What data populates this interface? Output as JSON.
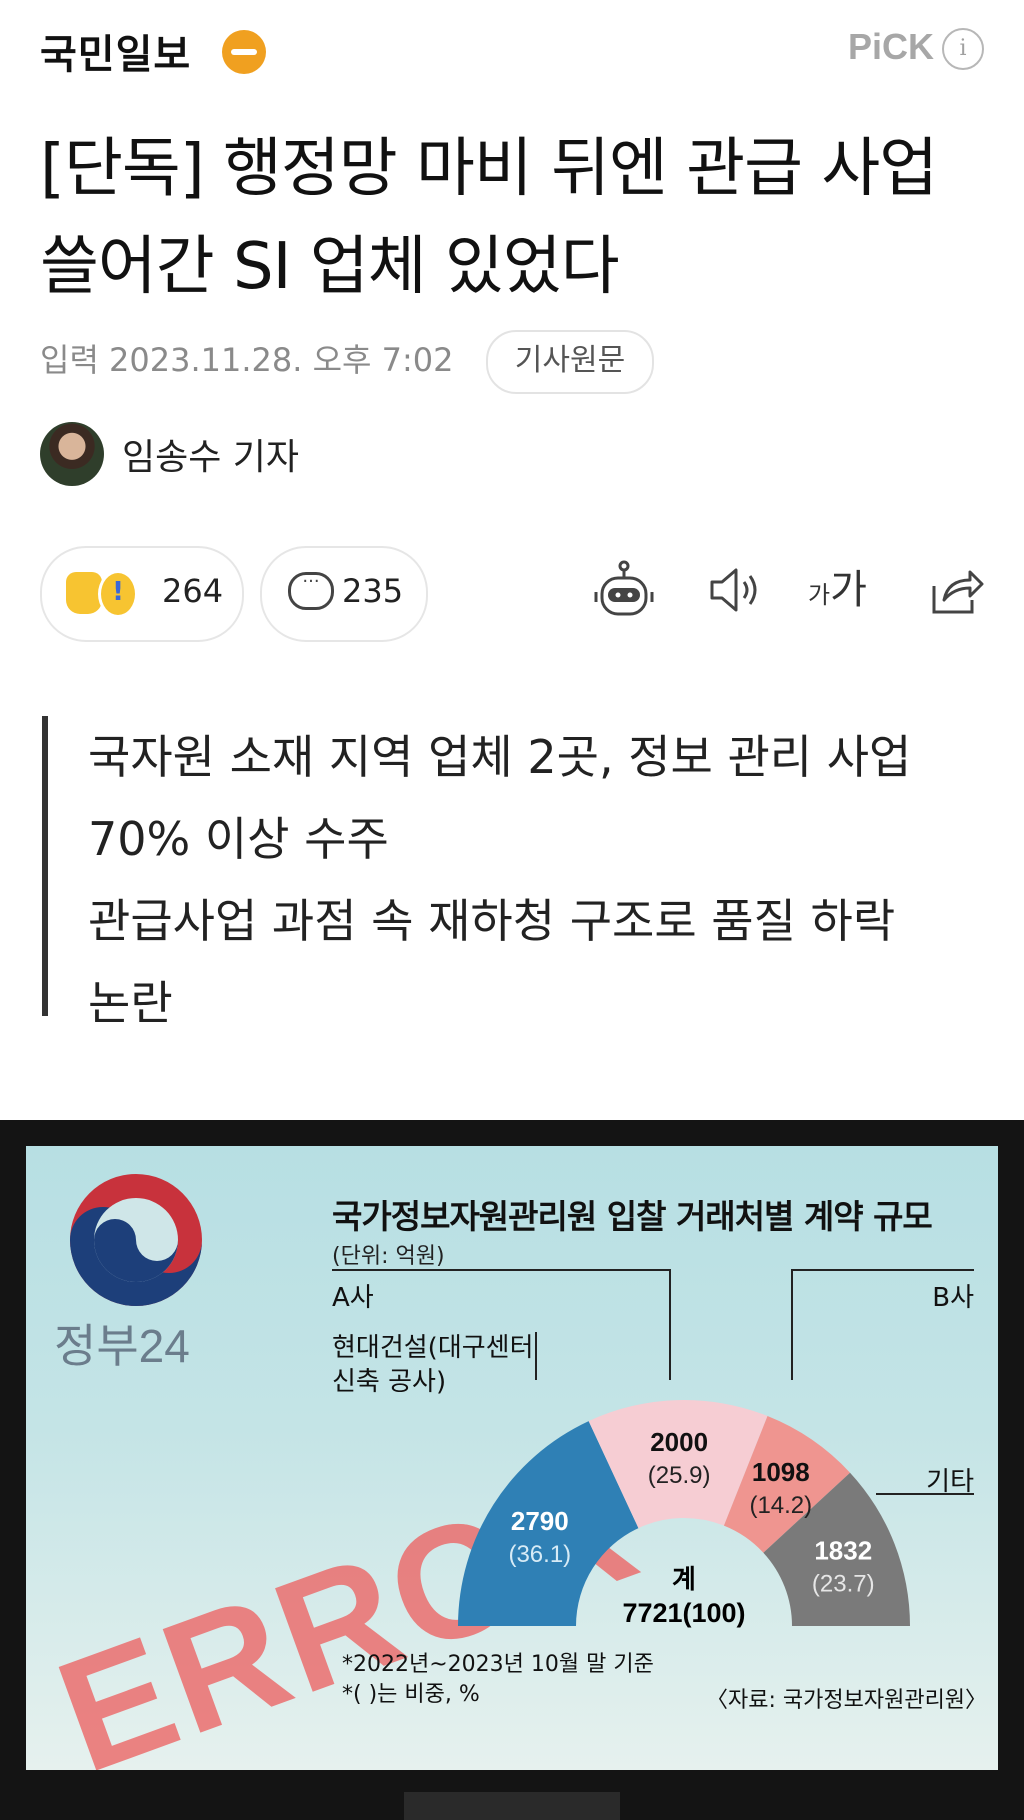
{
  "header": {
    "logo": "국민일보",
    "pick": "PiCK",
    "info_icon": "info-icon"
  },
  "article": {
    "title": "[단독] 행정망 마비 뒤엔 관급 사업 쓸어간 SI 업체 있었다",
    "date": "입력 2023.11.28. 오후 7:02",
    "original_button": "기사원문",
    "author": "임송수 기자",
    "reaction_count": "264",
    "comment_count": "235",
    "font_size_label_small": "가",
    "font_size_label_large": "가",
    "summary": [
      "국자원 소재 지역 업체 2곳, 정보 관리 사업",
      "70% 이상 수주",
      "관급사업 과점 속 재하청 구조로 품질 하락",
      "논란"
    ]
  },
  "figure": {
    "gov_name": "정부24",
    "error_text": "ERROR",
    "footnote_1": "*2022년~2023년 10월 말 기준",
    "footnote_2": "*(    )는 비중, %",
    "source": "〈자료: 국가정보자원관리원〉"
  },
  "chart_data": {
    "type": "pie",
    "title": "국가정보자원관리원 입찰 거래처별 계약 규모",
    "unit": "(단위: 억원)",
    "center_label": "계",
    "total": "7721(100)",
    "slices": [
      {
        "label": "현대건설(대구센터 신축 공사)",
        "value": 2790,
        "value_text": "2790",
        "share_text": "(36.1)",
        "color": "#2f80b5"
      },
      {
        "label": "A사",
        "value": 2000,
        "value_text": "2000",
        "share_text": "(25.9)",
        "color": "#f6cdd3"
      },
      {
        "label": "B사",
        "value": 1098,
        "value_text": "1098",
        "share_text": "(14.2)",
        "color": "#ef9590"
      },
      {
        "label": "기타",
        "value": 1832,
        "value_text": "1832",
        "share_text": "(23.7)",
        "color": "#7a7a7a"
      }
    ]
  }
}
